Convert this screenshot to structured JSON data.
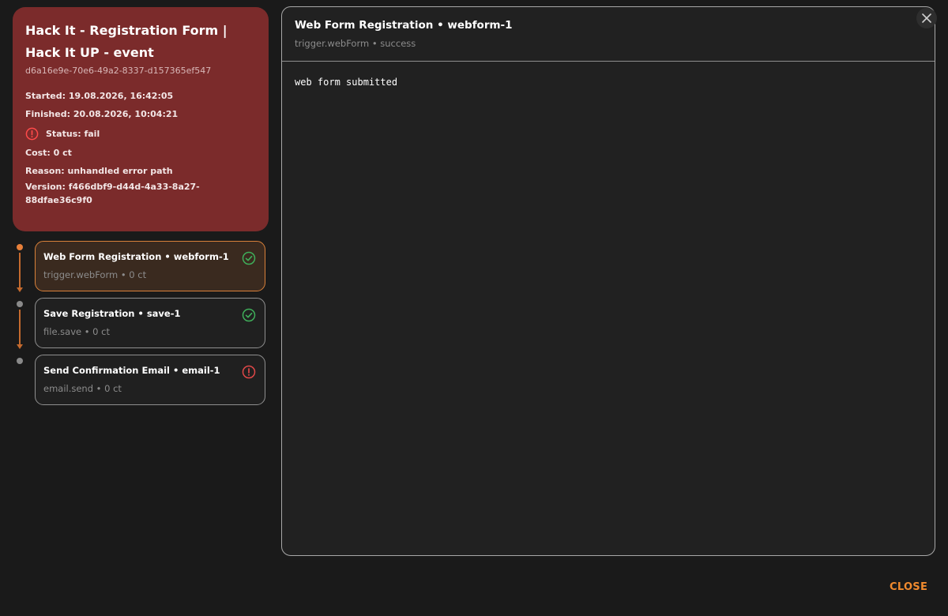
{
  "run": {
    "title": "Hack It - Registration Form | Hack It UP - event",
    "id": "d6a16e9e-70e6-49a2-8337-d157365ef547",
    "started": "Started: 19.08.2026, 16:42:05",
    "finished": "Finished: 20.08.2026, 10:04:21",
    "status": "Status: fail",
    "status_icon": "alert-circle-icon",
    "cost": "Cost: 0 ct",
    "reason": "Reason: unhandled error path",
    "version": "Version: f466dbf9-d44d-4a33-8a27-88dfae36c9f0",
    "card_color": "#7b2b2b"
  },
  "steps": [
    {
      "title": "Web Form Registration • webform-1",
      "subtitle": "trigger.webForm • 0 ct",
      "state": "success",
      "icon": "check-circle-icon",
      "selected": true
    },
    {
      "title": "Save Registration • save-1",
      "subtitle": "file.save • 0 ct",
      "state": "success",
      "icon": "check-circle-icon",
      "selected": false
    },
    {
      "title": "Send Confirmation Email • email-1",
      "subtitle": "email.send • 0 ct",
      "state": "fail",
      "icon": "alert-circle-icon",
      "selected": false
    }
  ],
  "detail": {
    "title": "Web Form Registration • webform-1",
    "subtitle": "trigger.webForm • success",
    "output": "web form submitted"
  },
  "dialog": {
    "close_label": "CLOSE",
    "close_icon": "close-icon"
  },
  "colors": {
    "accent": "#f08a2e",
    "success": "#3fae5a",
    "error": "#e04848"
  }
}
